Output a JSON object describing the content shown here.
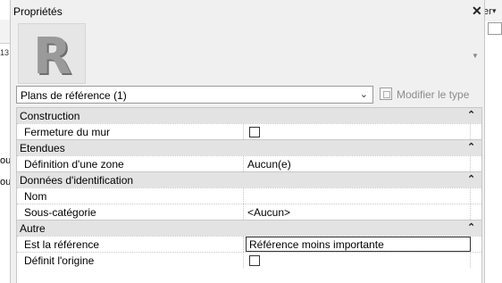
{
  "background": {
    "right_fragment_text": "er",
    "left_number": "13",
    "left_texts": [
      "ou",
      "ou"
    ]
  },
  "palette": {
    "title": "Propriétés",
    "type_selector": {
      "value": "Plans de référence (1)"
    },
    "modify_type_label": "Modifier le type",
    "groups": [
      {
        "label": "Construction",
        "rows": [
          {
            "name": "Fermeture du mur",
            "type": "checkbox",
            "checked": false
          }
        ]
      },
      {
        "label": "Etendues",
        "rows": [
          {
            "name": "Définition d'une zone",
            "type": "text",
            "value": "Aucun(e)"
          }
        ]
      },
      {
        "label": "Données d'identification",
        "rows": [
          {
            "name": "Nom",
            "type": "text",
            "value": ""
          },
          {
            "name": "Sous-catégorie",
            "type": "text",
            "value": "<Aucun>"
          }
        ]
      },
      {
        "label": "Autre",
        "rows": [
          {
            "name": "Est la référence",
            "type": "text",
            "value": "Référence moins importante"
          },
          {
            "name": "Définit l'origine",
            "type": "checkbox",
            "checked": false
          }
        ]
      }
    ]
  },
  "colors": {
    "panel_bg": "#f0f0f0",
    "category_bg": "#e3e3e3",
    "disabled_text": "#8c8c8c"
  }
}
